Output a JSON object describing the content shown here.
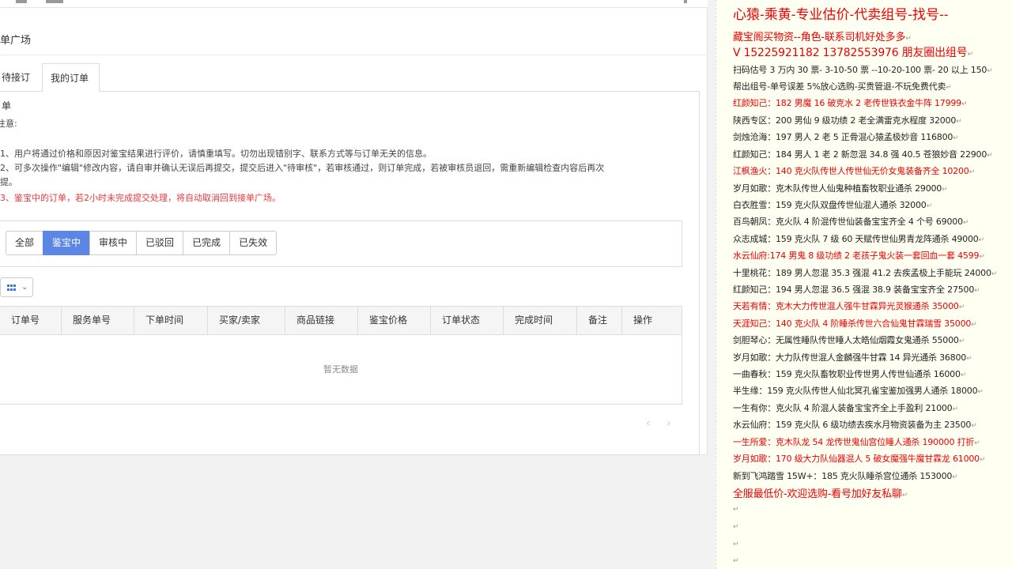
{
  "page": {
    "title": "单广场",
    "tabs": [
      "待接订单",
      "我的订单"
    ],
    "notice_title": "注意:",
    "notices": [
      {
        "text": "1、用户将通过价格和原因对鉴宝结果进行评价，请慎重填写。切勿出现错别字、联系方式等与订单无关的信息。",
        "red": false
      },
      {
        "text": "2、可多次操作\"编辑\"修改内容，请自审并确认无误后再提交，提交后进入\"待审核\"，若审核通过，则订单完成，若被审核员退回，需重新编辑检查内容后再次",
        "red": false
      },
      {
        "text": "提。",
        "red": false
      },
      {
        "text": "3、鉴宝中的订单，若2小时未完成提交处理，将自动取消回到接单广场。",
        "red": true
      }
    ],
    "filters": [
      "全部",
      "鉴宝中",
      "审核中",
      "已驳回",
      "已完成",
      "已失效"
    ],
    "active_filter": "鉴宝中",
    "columns": [
      "订单号",
      "服务单号",
      "下单时间",
      "买家/卖家",
      "商品链接",
      "鉴宝价格",
      "订单状态",
      "完成时间",
      "备注",
      "操作"
    ],
    "empty_text": "暂无数据",
    "pager_prev": "‹",
    "pager_next": "›"
  },
  "ad": {
    "title": "心猿-乘黄-专业估价-代卖组号-找号--",
    "watermark": "心猿",
    "lines": [
      {
        "text": "藏宝阁买物资--角色-联系司机好处多多",
        "red": true,
        "size": "big"
      },
      {
        "text": "V 15225921182   13782553976 朋友圈出组号",
        "red": true,
        "size": "big2"
      },
      {
        "text": "扫码估号 3 万内 30 票- 3-10-50 票   --10-20-100 票- 20 以上 150",
        "red": false
      },
      {
        "text": "帮出组号-单号误差 5%放心选购-买贵管退-不玩免费代卖",
        "red": false
      },
      {
        "text": "红颜知己：182 男魔 16 破克水 2 老传世铁衣金牛阵 17999",
        "red": true
      },
      {
        "text": "陕西专区：200 男仙 9 级功绩 2 老全满雷克水程度 32000",
        "red": false
      },
      {
        "text": "剑烛沧海：197 男人 2 老 5 正骨混心猿孟极妙音 116800",
        "red": false
      },
      {
        "text": "红颜知己：184 男人 1 老 2 新忽混 34.8 强 40.5 苍狼妙音 22900",
        "red": false
      },
      {
        "text": "江枫渔火：140 克火队传世人传世仙无价女鬼装备齐全 10200",
        "red": true
      },
      {
        "text": "岁月如歌：克木队传世人仙鬼种植畜牧职业通杀 29000",
        "red": false
      },
      {
        "text": "白衣胜雪：159 克火队双盘传世仙混人通杀 32000",
        "red": false
      },
      {
        "text": "百鸟朝凤：克火队 4 阶混传世仙装备宝宝齐全 4 个号 69000",
        "red": false
      },
      {
        "text": "众志成城：159 克火队 7 级 60 天赋传世仙男青龙阵通杀 49000",
        "red": false
      },
      {
        "text": "水云仙府:174 男鬼 8 级功绩 2 老孩子鬼火装一套回血一套 4599",
        "red": true
      },
      {
        "text": "十里桃花：189 男人忽混 35.3 强混 41.2 去疾孟极上手能玩 24000",
        "red": false
      },
      {
        "text": "红颜知己：194 男人忽混 36.5 强混 38.9 装备宝宝齐全 27500",
        "red": false
      },
      {
        "text": "天若有情：克木大力传世混人强牛甘霖异光灵猴通杀 35000",
        "red": true
      },
      {
        "text": "天涯知己：140 克火队 4 阶睡杀传世六合仙鬼甘霖瑞雪 35000",
        "red": true
      },
      {
        "text": "剑胆琴心：无属性睡队传世睡人太皓仙烟霞女鬼通杀 55000",
        "red": false
      },
      {
        "text": "岁月如歌：大力队传世混人金麟强牛甘霖 14 异光通杀 36800",
        "red": false
      },
      {
        "text": "一曲春秋：159 克火队畜牧职业传世男人传世仙通杀 16000",
        "red": false
      },
      {
        "text": "半生缘：159 克火队传世人仙北冥孔雀宝鉴加强男人通杀 18000",
        "red": false
      },
      {
        "text": "一生有你：克火队 4 阶混人装备宝宝齐全上手盈利 21000",
        "red": false
      },
      {
        "text": "水云仙府：159 克火队 6 级功绩去疾水月物资装备为主 23500",
        "red": false
      },
      {
        "text": "一生所爱：克木队龙 54 龙传世鬼仙宫位睡人通杀 190000 打折",
        "red": true
      },
      {
        "text": "岁月如歌：170 级大力队仙器混人 5 破女魔强牛魔甘霖龙 61000",
        "red": true
      },
      {
        "text": "新到飞鸿踏雪 15W+：185 克火队睡杀宫位通杀 153000",
        "red": false
      },
      {
        "text": "全服最低价-欢迎选购-看号加好友私聊",
        "red": true,
        "size": "big"
      }
    ]
  }
}
